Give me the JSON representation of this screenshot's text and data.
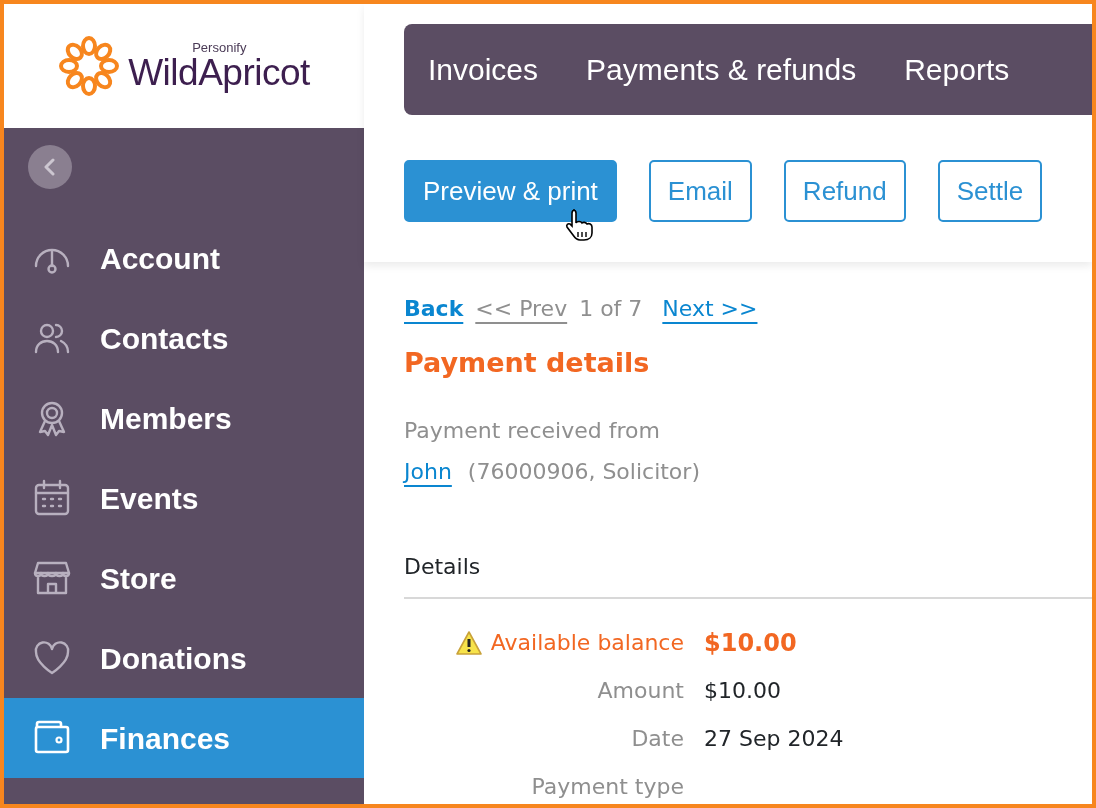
{
  "logo": {
    "brand_small": "Personify",
    "brand": "WildApricot"
  },
  "sidebar": {
    "items": [
      {
        "label": "Account",
        "selected": false
      },
      {
        "label": "Contacts",
        "selected": false
      },
      {
        "label": "Members",
        "selected": false
      },
      {
        "label": "Events",
        "selected": false
      },
      {
        "label": "Store",
        "selected": false
      },
      {
        "label": "Donations",
        "selected": false
      },
      {
        "label": "Finances",
        "selected": true
      }
    ]
  },
  "tabs": [
    {
      "label": "Invoices"
    },
    {
      "label": "Payments & refunds"
    },
    {
      "label": "Reports"
    }
  ],
  "buttons": [
    {
      "label": "Preview & print",
      "kind": "primary"
    },
    {
      "label": "Email",
      "kind": "outline"
    },
    {
      "label": "Refund",
      "kind": "outline"
    },
    {
      "label": "Settle",
      "kind": "outline"
    }
  ],
  "pager": {
    "back": "Back",
    "prev": {
      "label": "<< Prev",
      "disabled": true
    },
    "position": "1 of 7",
    "next": {
      "label": "Next >>",
      "disabled": false
    }
  },
  "title": "Payment details",
  "received": {
    "label": "Payment received from",
    "name": "John",
    "info": "(76000906, Solicitor)"
  },
  "section": "Details",
  "rows": [
    {
      "label": "Available balance",
      "value": "$10.00",
      "kind": "warning"
    },
    {
      "label": "Amount",
      "value": "$10.00",
      "kind": "plain"
    },
    {
      "label": "Date",
      "value": "27 Sep 2024",
      "kind": "plain"
    },
    {
      "label": "Payment type",
      "kind": "plain"
    }
  ]
}
